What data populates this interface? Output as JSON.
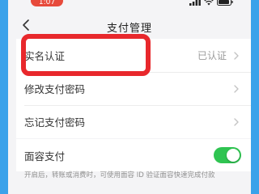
{
  "status_bar": {
    "time": "1:07"
  },
  "nav": {
    "title": "支付管理"
  },
  "rows": [
    {
      "label": "实名认证",
      "value": "已认证"
    },
    {
      "label": "修改支付密码"
    },
    {
      "label": "忘记支付密码"
    }
  ],
  "face_pay": {
    "label": "面容支付",
    "enabled": true
  },
  "footnote": "开启后，转账或消费时，可使用面容 ID 验证面容快速完成付款",
  "colors": {
    "accent_green": "#2fc451",
    "highlight_red": "#e8282c",
    "frame_blue": "#3aa2ea"
  }
}
